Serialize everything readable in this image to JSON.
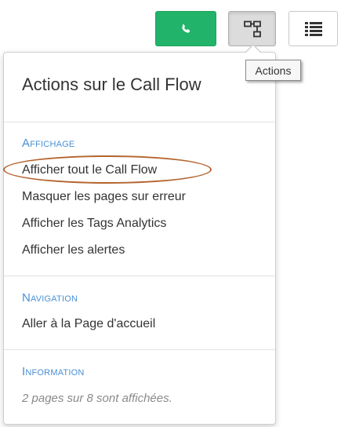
{
  "toolbar": {
    "phone_button_icon": "phone-icon",
    "flow_button_icon": "flowchart-icon",
    "list_button_icon": "list-icon",
    "phone_color": "#21b36a"
  },
  "tooltip": {
    "text": "Actions"
  },
  "panel": {
    "title": "Actions sur le Call Flow",
    "sections": [
      {
        "header": "Affichage",
        "items": [
          "Afficher tout le Call Flow",
          "Masquer les pages sur erreur",
          "Afficher les Tags Analytics",
          "Afficher les alertes"
        ]
      },
      {
        "header": "Navigation",
        "items": [
          "Aller à la Page d'accueil"
        ]
      },
      {
        "header": "Information",
        "text": "2 pages sur 8 sont affichées."
      }
    ]
  },
  "accent_color": "#4a8fd4",
  "highlight_color": "#b5642e"
}
